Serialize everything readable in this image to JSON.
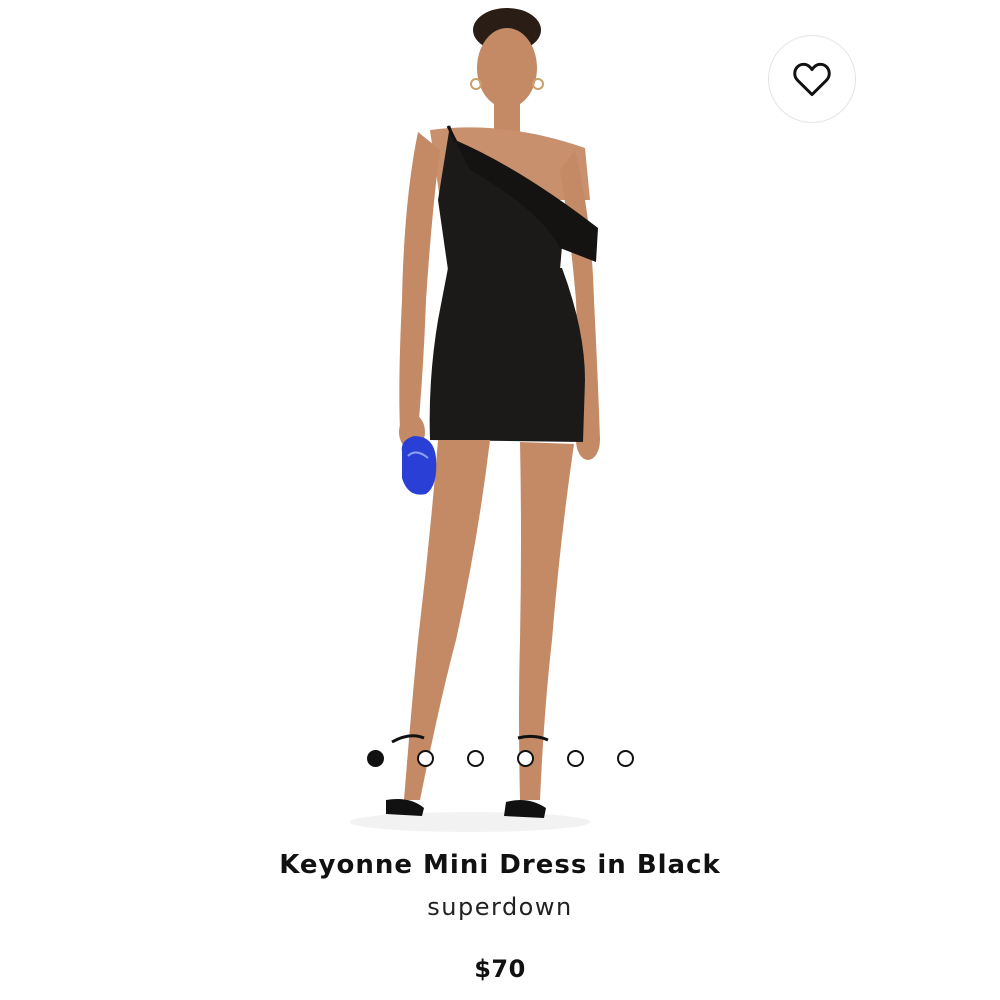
{
  "product": {
    "title": "Keyonne Mini Dress in Black",
    "brand": "superdown",
    "price": "$70",
    "image_alt": "Keyonne Mini Dress in Black"
  },
  "wishlist": {
    "icon": "heart-outline-icon",
    "state": "not-saved"
  },
  "carousel": {
    "total_images": 6,
    "active_index": 0
  },
  "colors": {
    "dress": "#1c1a19",
    "skin": "#c9906d",
    "clutch": "#2a3fd6",
    "text": "#111111"
  }
}
